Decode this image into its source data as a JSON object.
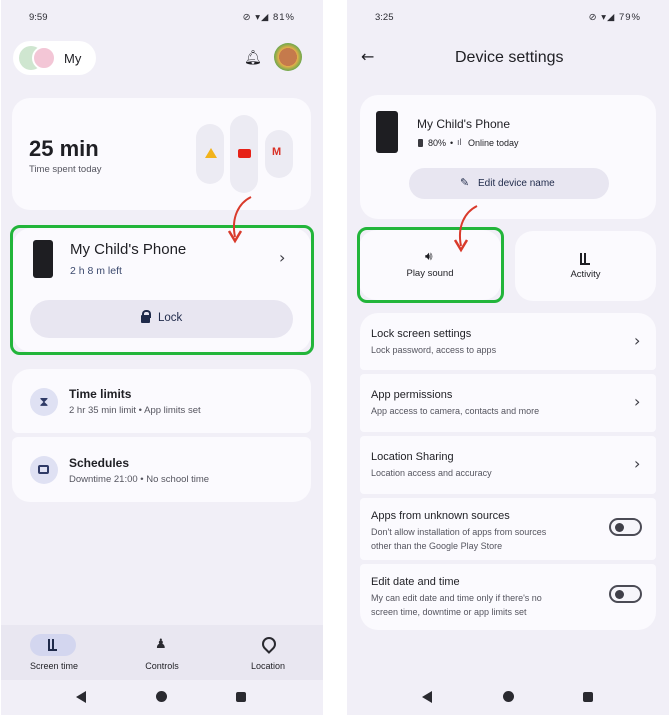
{
  "left": {
    "status": {
      "time": "9:59",
      "battery": "81%"
    },
    "profile": {
      "name": "My"
    },
    "usage": {
      "value": "25 min",
      "label": "Time spent today"
    },
    "device": {
      "name": "My Child's Phone",
      "time_left": "2 h 8 m left",
      "lock_label": "Lock"
    },
    "time_limits": {
      "title": "Time limits",
      "subtitle": "2 hr 35 min limit • App limits set"
    },
    "schedules": {
      "title": "Schedules",
      "subtitle": "Downtime 21:00 • No school time"
    },
    "bottom_nav": [
      "Screen time",
      "Controls",
      "Location"
    ]
  },
  "right": {
    "status": {
      "time": "3:25",
      "battery": "79%"
    },
    "title": "Device settings",
    "device": {
      "name": "My Child's Phone",
      "battery": "80%",
      "online": "Online today",
      "edit_label": "Edit device name"
    },
    "play_sound": "Play sound",
    "activity": "Activity",
    "settings": [
      {
        "title": "Lock screen settings",
        "subtitle": "Lock password, access to apps"
      },
      {
        "title": "App permissions",
        "subtitle": "App access to camera, contacts and more"
      },
      {
        "title": "Location Sharing",
        "subtitle": "Location access and accuracy"
      }
    ],
    "toggles": [
      {
        "title": "Apps from unknown sources",
        "line1": "Don't allow installation of apps from sources",
        "line2": "other than the Google Play Store"
      },
      {
        "title": "Edit date and time",
        "line1": "My can edit date and time only if there's no",
        "line2": "screen time, downtime or app limits set"
      }
    ]
  },
  "colors": {
    "highlight": "#22b53a",
    "arrow": "#d93a2b",
    "background": "#f1eff7",
    "card": "#fbfafe"
  }
}
